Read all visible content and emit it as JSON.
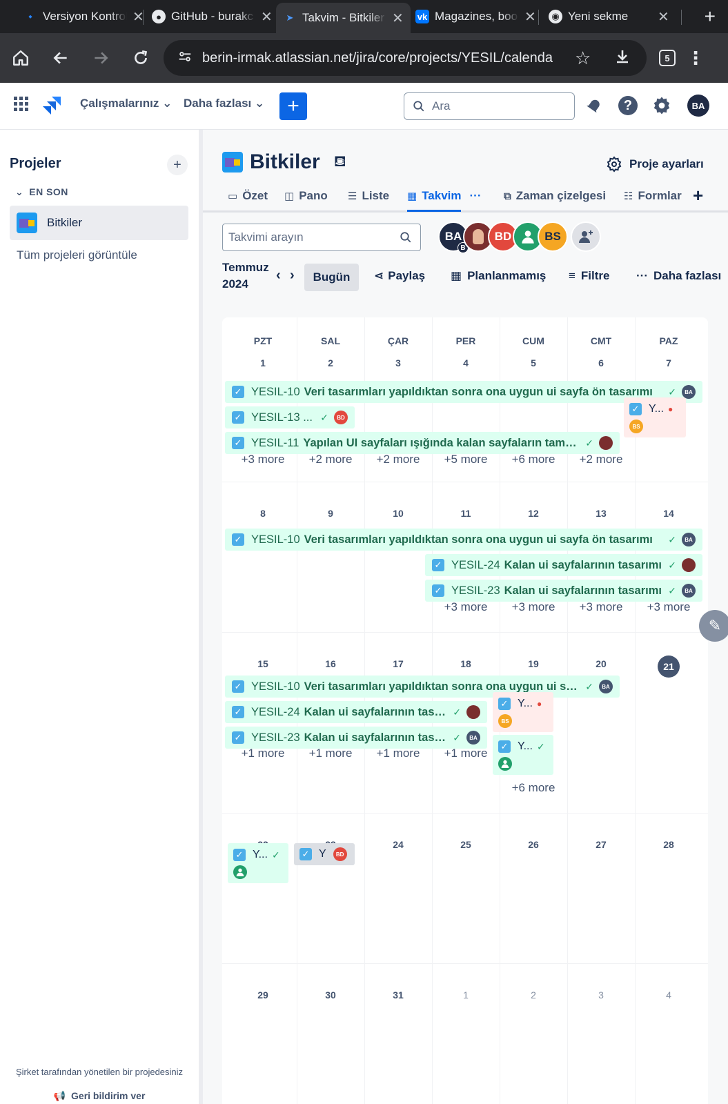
{
  "browser": {
    "tabs": [
      {
        "title": "Versiyon Kontrol",
        "icon": "bitbucket-icon"
      },
      {
        "title": "GitHub - burakc",
        "icon": "github-icon"
      },
      {
        "title": "Takvim - Bitkiler",
        "icon": "jira-icon",
        "active": true
      },
      {
        "title": "Magazines, boo",
        "icon": "vk-icon"
      },
      {
        "title": "Yeni sekme",
        "icon": "chrome-icon"
      }
    ],
    "url": "berin-irmak.atlassian.net/jira/core/projects/YESIL/calenda",
    "tab_count": "5"
  },
  "topnav": {
    "your_work": "Çalışmalarınız",
    "more": "Daha fazlası",
    "search_placeholder": "Ara",
    "user_initials": "BA",
    "accent": "#0c66e4"
  },
  "sidebar": {
    "title": "Projeler",
    "recent_label": "EN SON",
    "project_name": "Bitkiler",
    "view_all": "Tüm projeleri görüntüle",
    "footer_text": "Şirket tarafından yönetilen bir projedesiniz",
    "feedback": "Geri bildirim ver"
  },
  "project": {
    "name": "Bitkiler",
    "settings": "Proje ayarları",
    "tabs": [
      "Özet",
      "Pano",
      "Liste",
      "Takvim",
      "Zaman çizelgesi",
      "Formlar"
    ]
  },
  "calendar_toolbar": {
    "search_placeholder": "Takvimi arayın",
    "month": "Temmuz",
    "year": "2024",
    "today": "Bugün",
    "share": "Paylaş",
    "unscheduled": "Planlanmamış",
    "filter": "Filtre",
    "more": "Daha fazlası",
    "avatars": [
      {
        "initials": "BA",
        "color": "#1f2a44",
        "badge": "B"
      },
      {
        "initials": "",
        "color": "#7a2e2e"
      },
      {
        "initials": "BD",
        "color": "#e2483d"
      },
      {
        "initials": "",
        "color": "#22a06b"
      },
      {
        "initials": "BS",
        "color": "#f5a623"
      }
    ]
  },
  "calendar": {
    "weekdays": [
      "PZT",
      "SAL",
      "ÇAR",
      "PER",
      "CUM",
      "CMT",
      "PAZ"
    ],
    "weeks": [
      {
        "days": [
          "1",
          "2",
          "3",
          "4",
          "5",
          "6",
          "7"
        ],
        "more": [
          "+3 more",
          "+2 more",
          "+2 more",
          "+5 more",
          "+6 more",
          "+2 more",
          ""
        ]
      },
      {
        "days": [
          "8",
          "9",
          "10",
          "11",
          "12",
          "13",
          "14"
        ],
        "more": [
          "",
          "",
          "",
          "+3 more",
          "+3 more",
          "+3 more",
          "+3 more"
        ]
      },
      {
        "days": [
          "15",
          "16",
          "17",
          "18",
          "19",
          "20",
          "21"
        ],
        "more": [
          "+1 more",
          "+1 more",
          "+1 more",
          "+1 more",
          "+6 more",
          "",
          ""
        ]
      },
      {
        "days": [
          "22",
          "23",
          "24",
          "25",
          "26",
          "27",
          "28"
        ],
        "more": [
          "",
          "",
          "",
          "",
          "",
          "",
          ""
        ]
      },
      {
        "days": [
          "29",
          "30",
          "31",
          "1",
          "2",
          "3",
          "4"
        ],
        "more": [
          "",
          "",
          "",
          "",
          "",
          "",
          ""
        ]
      }
    ],
    "today": "21",
    "events": {
      "w1_e1": {
        "key": "YESIL-10",
        "summary": "Veri tasarımları yapıldıktan sonra ona uygun ui sayfa ön tasarımı",
        "avatar": "BA"
      },
      "w1_e2": {
        "key": "YESIL-13 ...",
        "summary": "",
        "avatar": "BD"
      },
      "w1_e3": {
        "key": "YESIL-11",
        "summary": "Yapılan UI sayfaları ışığında kalan sayfaların tamamlanması",
        "avatar": ""
      },
      "w1_e4": {
        "key": "Y...",
        "avatar": "BS"
      },
      "w2_e1": {
        "key": "YESIL-10",
        "summary": "Veri tasarımları yapıldıktan sonra ona uygun ui sayfa ön tasarımı",
        "avatar": "BA"
      },
      "w2_e2": {
        "key": "YESIL-24",
        "summary": "Kalan ui sayfalarının tasarımı",
        "avatar": ""
      },
      "w2_e3": {
        "key": "YESIL-23",
        "summary": "Kalan ui sayfalarının tasarımı",
        "avatar": "BA"
      },
      "w3_e1": {
        "key": "YESIL-10",
        "summary": "Veri tasarımları yapıldıktan sonra ona uygun ui sayfa ön tasarımı",
        "avatar": "BA"
      },
      "w3_e2": {
        "key": "YESIL-24",
        "summary": "Kalan ui sayfalarının tasarımı",
        "avatar": ""
      },
      "w3_e3": {
        "key": "YESIL-23",
        "summary": "Kalan ui sayfalarının tasarımı",
        "avatar": "BA"
      },
      "w3_e4": {
        "key": "Y...",
        "avatar": "BS"
      },
      "w3_e5": {
        "key": "Y...",
        "avatar": ""
      },
      "w4_e1": {
        "key": "Y...",
        "avatar": ""
      },
      "w4_e2": {
        "key": "Y",
        "avatar": "BD"
      }
    }
  }
}
